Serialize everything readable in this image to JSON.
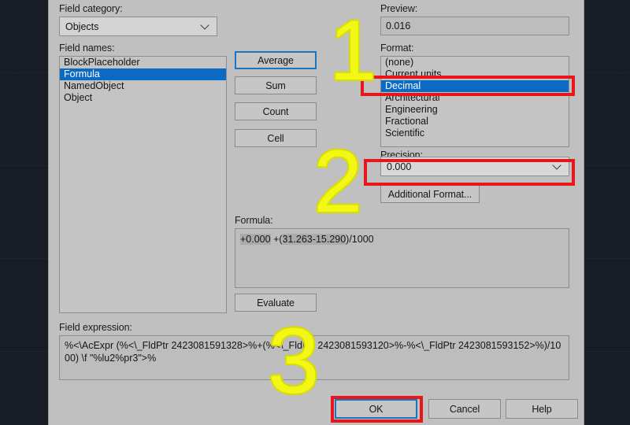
{
  "background": {
    "app": "AutoCAD drawing area",
    "color": "#171c25"
  },
  "dialog": {
    "field_category": {
      "label": "Field category:",
      "value": "Objects"
    },
    "field_names": {
      "label": "Field names:",
      "items": [
        "BlockPlaceholder",
        "Formula",
        "NamedObject",
        "Object"
      ],
      "selected_index": 1
    },
    "function_buttons": [
      {
        "label": "Average",
        "focused": true
      },
      {
        "label": "Sum",
        "focused": false
      },
      {
        "label": "Count",
        "focused": false
      },
      {
        "label": "Cell",
        "focused": false
      }
    ],
    "preview": {
      "label": "Preview:",
      "value": "0.016"
    },
    "format": {
      "label": "Format:",
      "items": [
        "(none)",
        "Current units",
        "Decimal",
        "Architectural",
        "Engineering",
        "Fractional",
        "Scientific"
      ],
      "selected_index": 2
    },
    "precision": {
      "label": "Precision:",
      "value": "0.000"
    },
    "additional_format": {
      "label": "Additional Format..."
    },
    "formula": {
      "label": "Formula:",
      "parts": [
        {
          "text": "+0.000",
          "field": true
        },
        {
          "text": " +(",
          "field": false
        },
        {
          "text": "31.263",
          "field": true
        },
        {
          "text": "-",
          "field": false
        },
        {
          "text": "15.290",
          "field": true
        },
        {
          "text": ")/1000",
          "field": false
        }
      ],
      "plain": "+0.000 +(31.263-15.290)/1000"
    },
    "evaluate": {
      "label": "Evaluate"
    },
    "field_expression": {
      "label": "Field expression:",
      "value": "%<\\AcExpr (%<\\_FldPtr 2423081591328>%+(%<\\_FldPtr 2423081593120>%-%<\\_FldPtr 2423081593152>%)/1000) \\f \"%lu2%pr3\">%"
    },
    "footer_buttons": [
      {
        "label": "OK",
        "focused": true
      },
      {
        "label": "Cancel",
        "focused": false
      },
      {
        "label": "Help",
        "focused": false
      }
    ]
  },
  "annotations": {
    "accent_red": "#e8151b",
    "accent_yellow": "#f2f715",
    "steps": [
      {
        "number": "1",
        "target": "format-list-decimal"
      },
      {
        "number": "2",
        "target": "precision-combobox"
      },
      {
        "number": "3",
        "target": "ok-button"
      }
    ]
  }
}
